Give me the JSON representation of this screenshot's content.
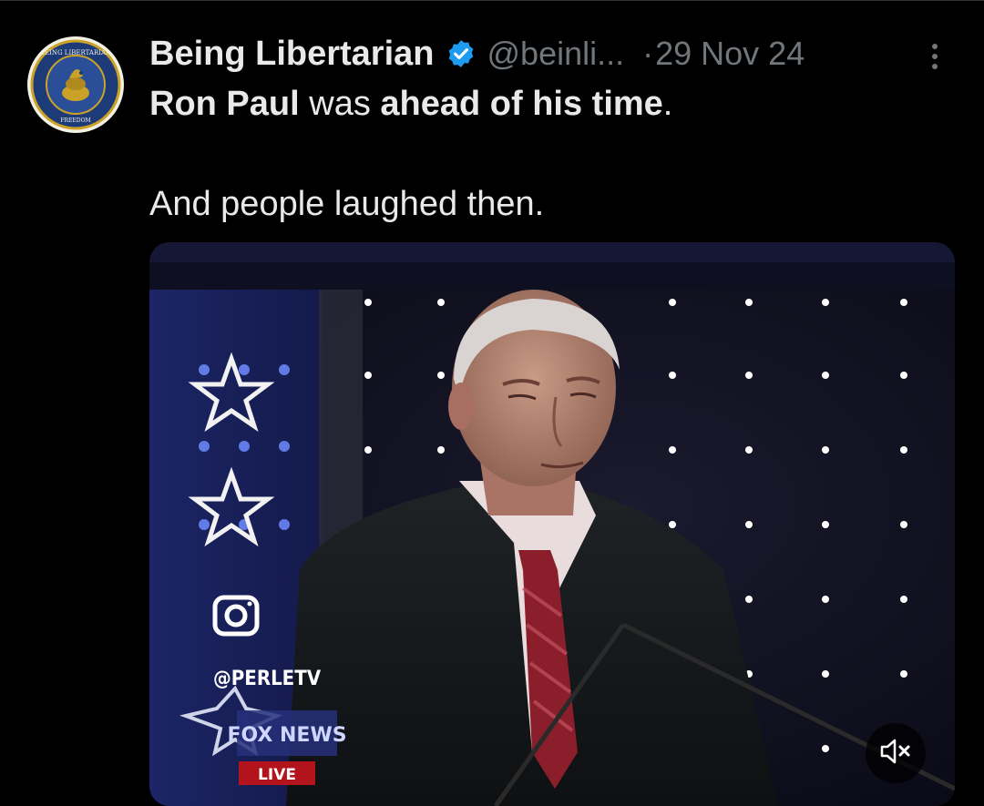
{
  "tweet": {
    "author_name": "Being Libertarian",
    "handle": "@beinli...",
    "separator": "·",
    "date": "29 Nov 24",
    "text_segments": [
      {
        "text": "Ron Paul",
        "bold": true
      },
      {
        "text": " was ",
        "bold": false
      },
      {
        "text": "ahead of his time",
        "bold": true
      },
      {
        "text": ".",
        "bold": false
      }
    ],
    "second_paragraph": "And people laughed then."
  },
  "avatar": {
    "logo_text": "BEING LIBERTARIAN",
    "logo_subtext": "FREEDOM",
    "colors": {
      "ring": "#1c3b78",
      "gold": "#c9a227"
    }
  },
  "video": {
    "watermark_handle": "@PERLETV",
    "broadcast_logo": "FOX NEWS",
    "live_label": "LIVE",
    "mute_icon": "speaker-muted-icon"
  },
  "colors": {
    "background": "#000000",
    "text_primary": "#e7e9ea",
    "text_secondary": "#71767b",
    "verified_blue": "#1d9bf0"
  }
}
